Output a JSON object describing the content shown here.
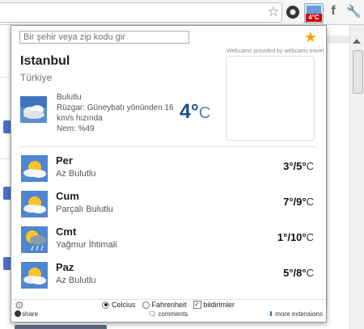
{
  "browser": {
    "toolbar_icons": [
      "star-icon",
      "extension-icon",
      "weather-extension-icon",
      "facebook-icon",
      "wrench-icon"
    ],
    "weather_badge": "4°C"
  },
  "popup": {
    "search_placeholder": "Bir şehir veya zip kodu gir",
    "webcam_note": "Webcams provided by webcams.travel",
    "current": {
      "city": "Istanbul",
      "country": "Türkiye",
      "condition": "Bulutlu",
      "wind": "Rüzgar: Güneybatı yönünden 16 km/s hızında",
      "humidity": "Nem: %49",
      "temp": "4°",
      "unit": "C"
    },
    "forecast": [
      {
        "day": "Per",
        "condition": "Az Bulutlu",
        "low": "3°",
        "high": "5°",
        "unit": "C",
        "icon": "partly-cloudy-icon"
      },
      {
        "day": "Cum",
        "condition": "Parçalı Bulutlu",
        "low": "7°",
        "high": "9°",
        "unit": "C",
        "icon": "partly-cloudy-icon"
      },
      {
        "day": "Cmt",
        "condition": "Yağmur İhtimali",
        "low": "1°",
        "high": "10°",
        "unit": "C",
        "icon": "chance-of-rain-icon"
      },
      {
        "day": "Paz",
        "condition": "Az Bulutlu",
        "low": "5°",
        "high": "8°",
        "unit": "C",
        "icon": "partly-cloudy-icon"
      }
    ],
    "footer": {
      "celsius_label": "Celcius",
      "fahrenheit_label": "Fahrenheit",
      "notifications_label": "bildirimler",
      "share_label": "share",
      "comments_label": "comments",
      "more_label": "more extensions",
      "selected_unit": "Celcius"
    }
  },
  "colors": {
    "temp_current": "#1f4f8a",
    "badge": "#d20000",
    "favorite_star": "#f5a60a"
  }
}
